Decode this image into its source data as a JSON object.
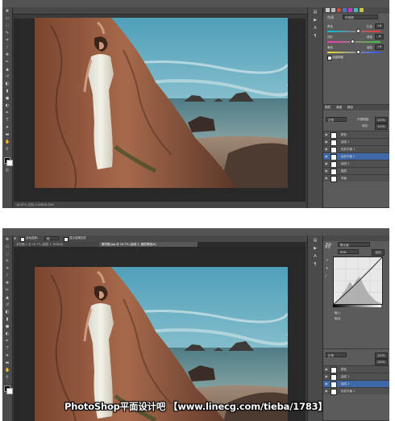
{
  "top_screenshot": {
    "menu": [
      "PS",
      "文件(F)",
      "编辑(E)",
      "图像(I)",
      "图层(L)",
      "文字(Y)",
      "选择(S)",
      "滤镜(T)",
      "3D(D)",
      "视图(V)",
      "窗口(W)",
      "帮助(H)"
    ],
    "status": "16.67%  文档: 2.06M/8.25M",
    "color_balance": {
      "tone_label": "色调",
      "tone_value": "中间调",
      "rows": [
        {
          "left": "青色",
          "right": "红色",
          "value": "+8"
        },
        {
          "left": "洋红",
          "right": "绿色",
          "value": "-8"
        },
        {
          "left": "黄色",
          "right": "蓝色",
          "value": "+8"
        }
      ],
      "preserve": "保留明度"
    },
    "layers_panel": {
      "tabs": [
        "图层",
        "通道",
        "路径"
      ],
      "blend_mode": "正常",
      "opacity_label": "不透明度:",
      "opacity": "100%",
      "fill_label": "填充:",
      "fill": "100%",
      "layers": [
        {
          "name": "颜色",
          "selected": false
        },
        {
          "name": "曲线 1",
          "selected": false
        },
        {
          "name": "色彩平衡 1",
          "selected": false
        },
        {
          "name": "色彩平衡 2",
          "selected": true
        },
        {
          "name": "曲线 2",
          "selected": false
        },
        {
          "name": "图层",
          "selected": false
        },
        {
          "name": "背景",
          "selected": false
        }
      ]
    }
  },
  "bottom_screenshot": {
    "menu": [
      "PS",
      "文件(F)",
      "编辑(E)",
      "图像(I)",
      "图层(L)",
      "文字(Y)",
      "选择(S)",
      "滤镜(T)",
      "3D(D)",
      "视图(V)",
      "窗口(W)",
      "帮助(H)"
    ],
    "option_auto_select": "自动选择:",
    "option_group": "组",
    "option_show_transform": "显示变换控件",
    "workspace": "基本功能",
    "tabs": [
      "未标题-1 @ 16.7% (图层 1, RGB/8)",
      "素材图.jpg @ 16.7% (曲线 2, 图层蒙版/8)"
    ],
    "curves_panel": {
      "tab": "属性",
      "preset_label": "预设:",
      "preset_value": "默认值",
      "channel_value": "RGB",
      "auto": "自动",
      "input_label": "输入:",
      "output_label": "输出:"
    },
    "layers_panel": {
      "blend_mode": "正常",
      "opacity": "100%",
      "fill": "100%",
      "layers": [
        {
          "name": "颜色",
          "selected": false
        },
        {
          "name": "曲线 1",
          "selected": false
        },
        {
          "name": "曲线 2",
          "selected": true
        },
        {
          "name": "色彩平衡 1",
          "selected": false
        }
      ]
    }
  },
  "watermark": "PhotoShop平面设计吧 【www.linecg.com/tieba/1783】"
}
